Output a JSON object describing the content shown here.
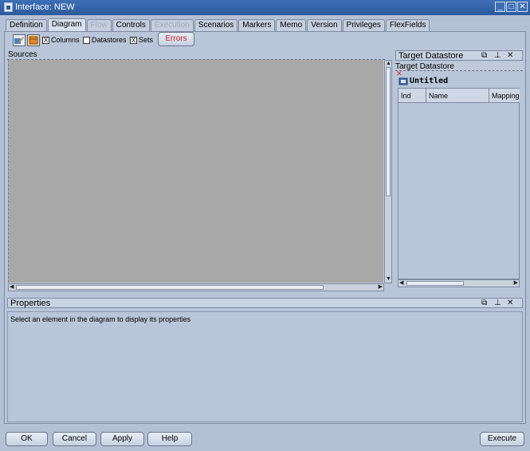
{
  "window": {
    "title": "Interface: NEW",
    "controls": [
      "_",
      "□",
      "✕"
    ]
  },
  "tabs": [
    {
      "label": "Definition",
      "state": "normal"
    },
    {
      "label": "Diagram",
      "state": "active"
    },
    {
      "label": "Flow",
      "state": "disabled"
    },
    {
      "label": "Controls",
      "state": "normal"
    },
    {
      "label": "Execution",
      "state": "disabled"
    },
    {
      "label": "Scenarios",
      "state": "normal"
    },
    {
      "label": "Markers",
      "state": "normal"
    },
    {
      "label": "Memo",
      "state": "normal"
    },
    {
      "label": "Version",
      "state": "normal"
    },
    {
      "label": "Privileges",
      "state": "normal"
    },
    {
      "label": "FlexFields",
      "state": "normal"
    }
  ],
  "toolbar": {
    "columns_label": "Columns",
    "columns_checked": true,
    "datastores_label": "Datastores",
    "datastores_checked": false,
    "sets_label": "Sets",
    "sets_checked": true,
    "errors_label": "Errors",
    "errors_color": "#cc2222",
    "check_mark": "X"
  },
  "sources": {
    "header": "Sources"
  },
  "target": {
    "panel_title": "Target Datastore",
    "subheader": "Target Datastore",
    "datastore_name": "Untitled",
    "columns": [
      "Ind",
      "Name",
      "Mapping"
    ]
  },
  "properties": {
    "title": "Properties",
    "hint": "Select an element in the diagram to display its properties"
  },
  "buttons": {
    "ok": "OK",
    "cancel": "Cancel",
    "apply": "Apply",
    "help": "Help",
    "execute": "Execute"
  },
  "panel_controls": {
    "float": "⧉",
    "pin": "⊥",
    "close": "✕"
  },
  "icons": {
    "scroll_left": "◀",
    "scroll_right": "▶",
    "scroll_up": "▲",
    "scroll_down": "▼",
    "grip": "⦀"
  },
  "colors": {
    "titlebar": "#2c5a9c",
    "canvas": "#a8a8a8",
    "window_bg": "#b4c0d4"
  }
}
